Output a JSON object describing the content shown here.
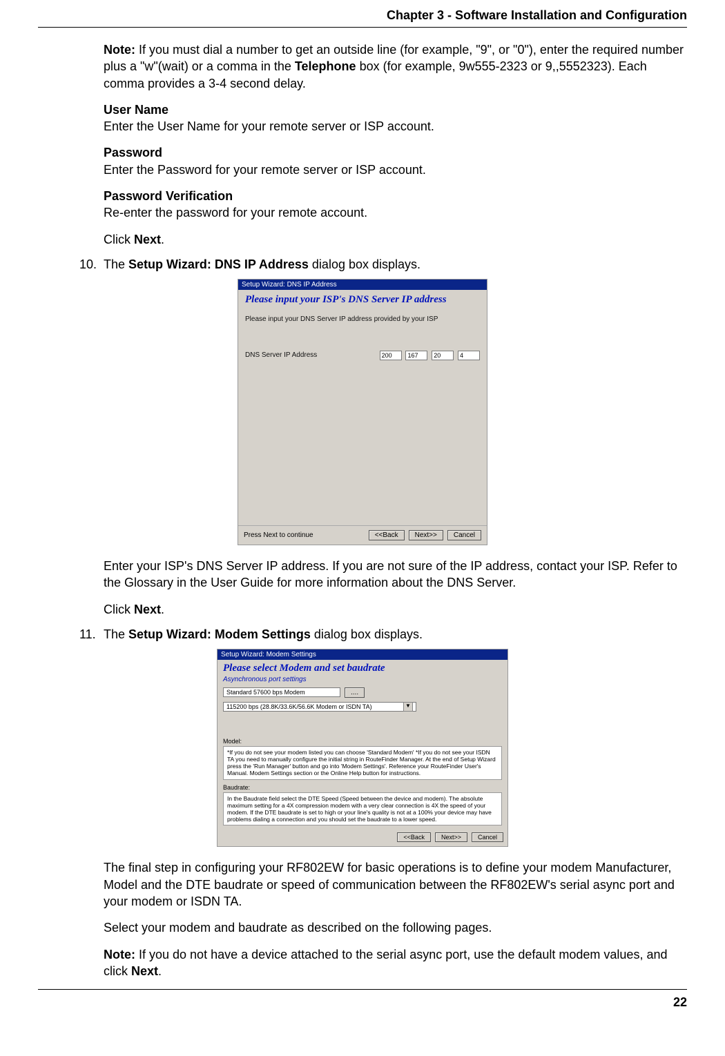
{
  "header": {
    "chapter": "Chapter 3 - Software Installation and Configuration"
  },
  "p1": {
    "note_label": "Note:",
    "note_text_a": " If you must dial a number to get an outside line (for example, \"9\", or \"0\"), enter the required number  plus a \"w\"(wait) or a comma in the ",
    "note_bold": "Telephone",
    "note_text_b": " box (for example, 9w555-2323 or 9,,5552323).  Each comma provides a 3-4 second delay."
  },
  "username": {
    "label": "User Name",
    "text": "Enter the User Name for your remote server or  ISP account."
  },
  "password": {
    "label": "Password",
    "text": "Enter the Password for your remote server or ISP account."
  },
  "pwverify": {
    "label": "Password Verification",
    "text": "Re-enter the password for your remote account."
  },
  "click_next_a": "Click ",
  "click_next_b": "Next",
  "click_next_c": ".",
  "step10": {
    "num": "10.",
    "pre": "The ",
    "bold": "Setup Wizard: DNS IP Address",
    "post": " dialog box displays."
  },
  "dlg1": {
    "title": "Setup Wizard: DNS IP Address",
    "heading": "Please input your ISP's DNS Server IP address",
    "instruction": "Please input your DNS Server IP address provided by your ISP",
    "label": "DNS Server IP Address",
    "ip": [
      "200",
      "167",
      "20",
      "4"
    ],
    "continue": "Press Next to continue",
    "back": "<<Back",
    "next": "Next>>",
    "cancel": "Cancel"
  },
  "after10a": "Enter your ISP's DNS Server IP address.  If you are not sure of the IP address, contact your ISP.  Refer to the Glossary in the User Guide for more information about the DNS Server.",
  "step11": {
    "num": "11.",
    "pre": "The ",
    "bold": "Setup Wizard: Modem Settings",
    "post": " dialog box displays."
  },
  "dlg2": {
    "title": "Setup Wizard: Modem Settings",
    "heading": "Please select Modem and set baudrate",
    "sub": "Asynchronous port settings",
    "combo1": "Standard 57600 bps Modem",
    "browse": "....",
    "combo2": "115200 bps (28.8K/33.6K/56.6K Modem or ISDN TA)",
    "model_lbl": "Model:",
    "model_text": "*If you do not see your modem listed you can choose 'Standard Modem'\n*If you do not see your ISDN TA you need to manually configure the initial string in RouteFinder Manager.  At the end of Setup Wizard press the 'Run Manager' button and go into 'Modem Settings'.  Reference your RouteFinder User's Manual.  Modem Settings section or the Online Help button for instructions.",
    "baud_lbl": "Baudrate:",
    "baud_text": "In the Baudrate field select the DTE Speed (Speed between the device and modem).  The absolute maximum setting for a 4X compression modem with a very clear connection is 4X the speed of your modem. If the DTE baudrate is set to high or your line's quality is not at a 100% your device may have problems dialing a connection and you should set the baudrate to a lower speed.",
    "back": "<<Back",
    "next": "Next>>",
    "cancel": "Cancel"
  },
  "after11a": "The final step in configuring your RF802EW for basic operations is to define your modem Manufacturer, Model and the DTE baudrate or speed of communication between the RF802EW's serial async port and your modem or ISDN TA.",
  "after11b": "Select your modem and baudrate as described on the following pages.",
  "after11c_label": "Note:",
  "after11c_text_a": "  If you do not have a device attached to the serial async port, use the default modem values, and click ",
  "after11c_bold": "Next",
  "after11c_text_b": ".",
  "pagenum": "22"
}
